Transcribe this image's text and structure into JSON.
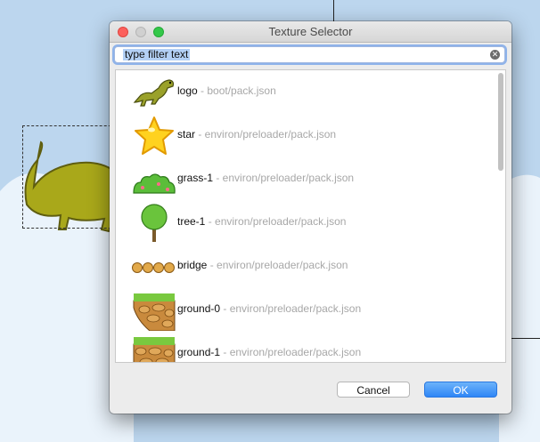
{
  "window": {
    "title": "Texture Selector"
  },
  "search": {
    "value": "type filter text"
  },
  "items": [
    {
      "name": "logo",
      "path": " - boot/pack.json",
      "icon": "dinosaur-icon"
    },
    {
      "name": "star",
      "path": " - environ/preloader/pack.json",
      "icon": "star-icon"
    },
    {
      "name": "grass-1",
      "path": " - environ/preloader/pack.json",
      "icon": "grass-bush-icon"
    },
    {
      "name": "tree-1",
      "path": " - environ/preloader/pack.json",
      "icon": "tree-icon"
    },
    {
      "name": "bridge",
      "path": " - environ/preloader/pack.json",
      "icon": "bridge-icon"
    },
    {
      "name": "ground-0",
      "path": " - environ/preloader/pack.json",
      "icon": "ground-block-icon"
    },
    {
      "name": "ground-1",
      "path": " - environ/preloader/pack.json",
      "icon": "ground-block-icon"
    }
  ],
  "buttons": {
    "cancel": "Cancel",
    "ok": "OK"
  },
  "colors": {
    "accent": "#2f86f6",
    "sky": "#bcd6ee",
    "dino": "#a9a81a"
  }
}
